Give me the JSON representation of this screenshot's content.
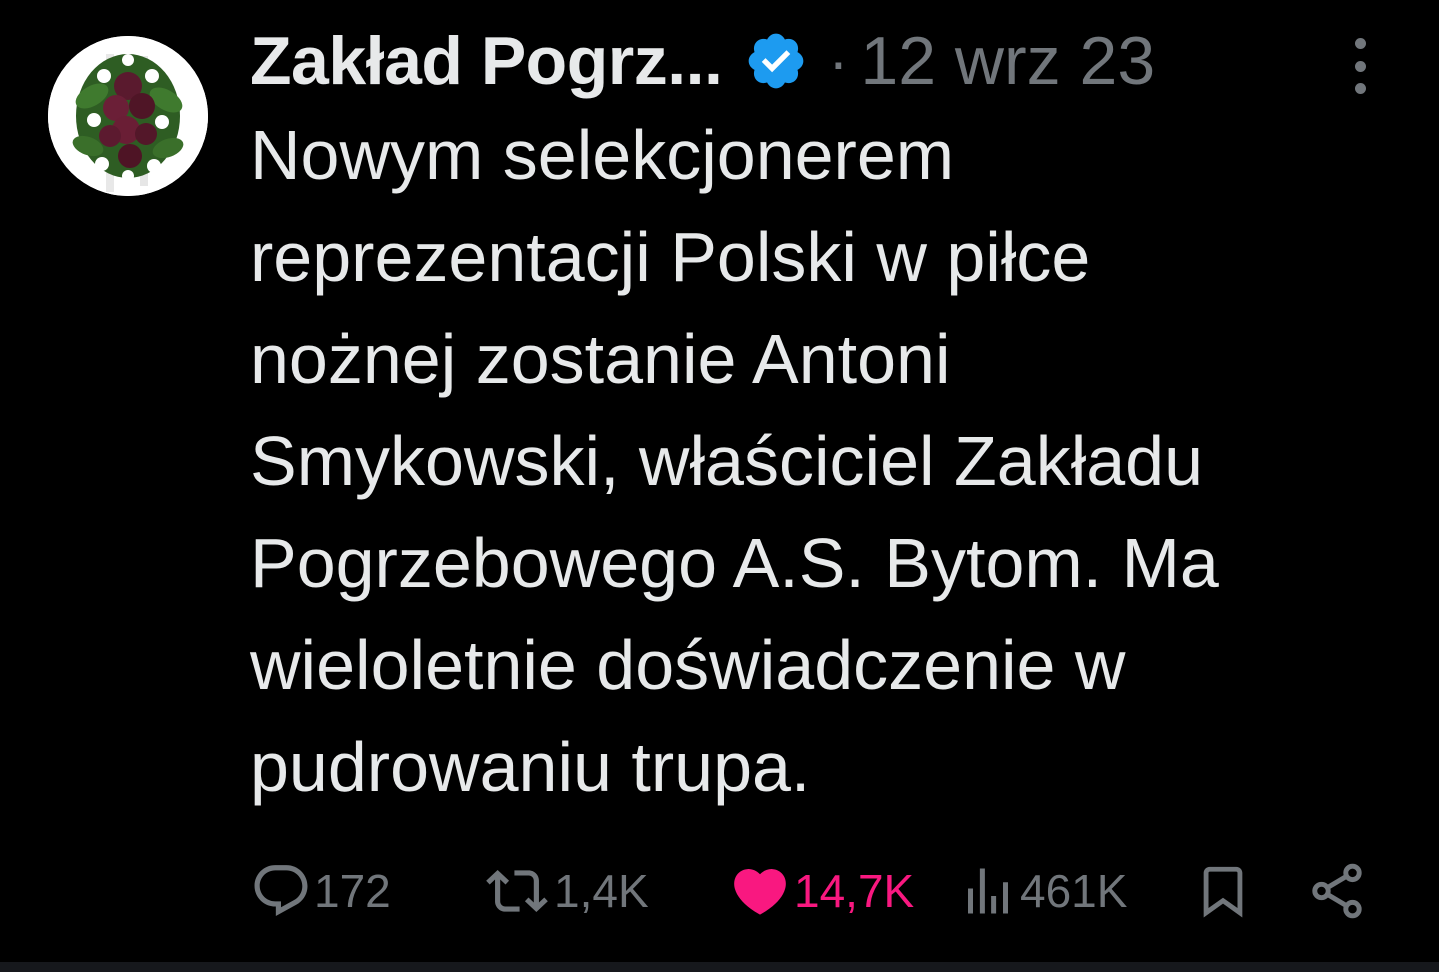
{
  "author": {
    "display_name": "Zakład Pogrz...",
    "verified": true,
    "avatar": "funeral-wreath-avatar"
  },
  "separator": "·",
  "date": "12 wrz 23",
  "tweet": {
    "text": "Nowym selekcjonerem\nreprezentacji Polski w piłce\nnożnej zostanie Antoni\nSmykowski, właściciel Zakładu\nPogrzebowego A.S. Bytom. Ma\nwieloletnie doświadczenie w\npudrowaniu trupa."
  },
  "actions": {
    "replies": "172",
    "retweets": "1,4K",
    "likes": "14,7K",
    "views": "461K"
  },
  "icons": {
    "reply": "reply-icon",
    "retweet": "retweet-icon",
    "like": "heart-icon",
    "views": "views-icon",
    "bookmark": "bookmark-icon",
    "share": "share-icon",
    "more": "more-options-icon",
    "verified": "verified-badge-icon"
  },
  "colors": {
    "background": "#000000",
    "text": "#e7e9ea",
    "muted": "#71767b",
    "verified": "#1d9bf0",
    "like": "#f91880"
  }
}
